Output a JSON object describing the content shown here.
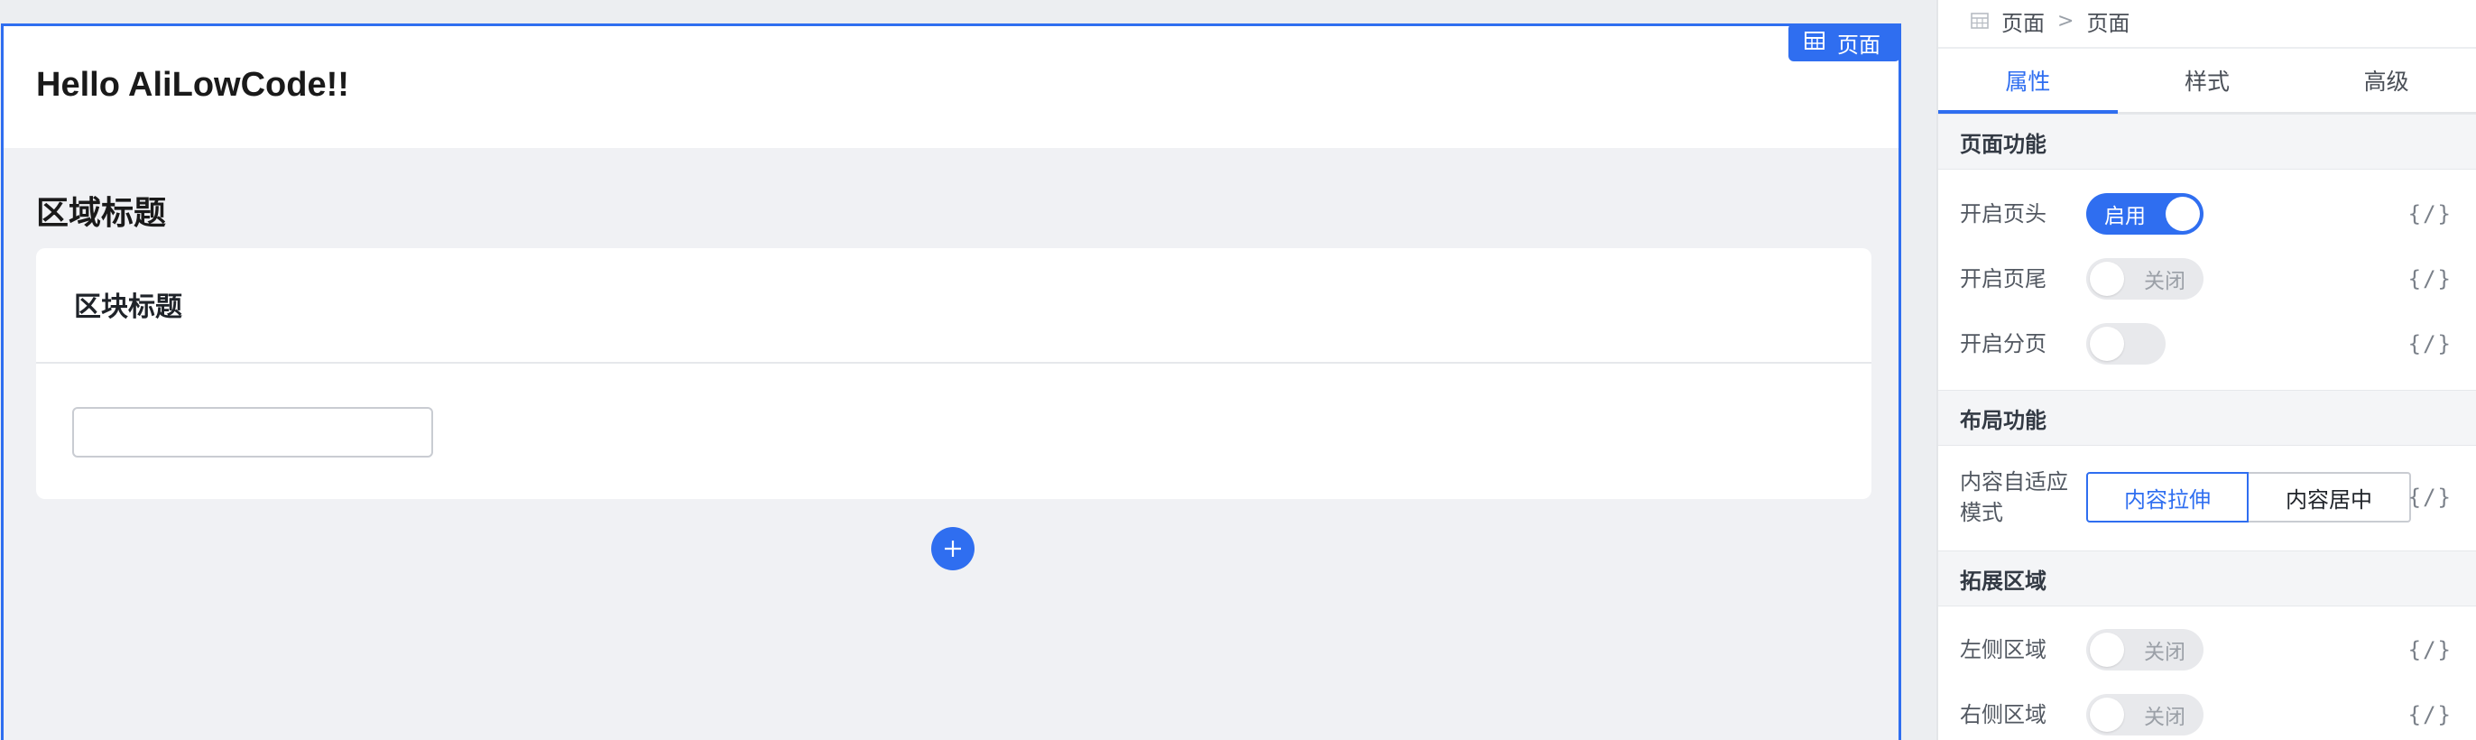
{
  "canvas": {
    "page_tag_label": "页面",
    "page_header_title": "Hello AliLowCode!!",
    "section_title": "区域标题",
    "card_title": "区块标题",
    "card_input": {
      "value": "",
      "placeholder": ""
    },
    "accent_color": "#2f6ef0"
  },
  "panel": {
    "breadcrumb": [
      "页面",
      "页面"
    ],
    "tabs": [
      {
        "label": "属性",
        "active": true
      },
      {
        "label": "样式",
        "active": false
      },
      {
        "label": "高级",
        "active": false
      }
    ],
    "sections": {
      "page_features": {
        "title": "页面功能",
        "rows": [
          {
            "label": "开启页头",
            "state": "on",
            "switch_text": "启用",
            "code": "{/}"
          },
          {
            "label": "开启页尾",
            "state": "off",
            "switch_text": "关闭",
            "code": "{/}"
          },
          {
            "label": "开启分页",
            "state": "off",
            "switch_text": "",
            "code": "{/}"
          }
        ]
      },
      "layout_features": {
        "title": "布局功能",
        "row": {
          "label_line1": "内容自适应",
          "label_line2": "模式",
          "options": [
            "内容拉伸",
            "内容居中"
          ],
          "selected": "内容拉伸",
          "code": "{/}"
        }
      },
      "extension_areas": {
        "title": "拓展区域",
        "rows": [
          {
            "label": "左侧区域",
            "state": "off",
            "switch_text": "关闭",
            "code": "{/}"
          },
          {
            "label": "右侧区域",
            "state": "off",
            "switch_text": "关闭",
            "code": "{/}"
          }
        ]
      }
    }
  }
}
